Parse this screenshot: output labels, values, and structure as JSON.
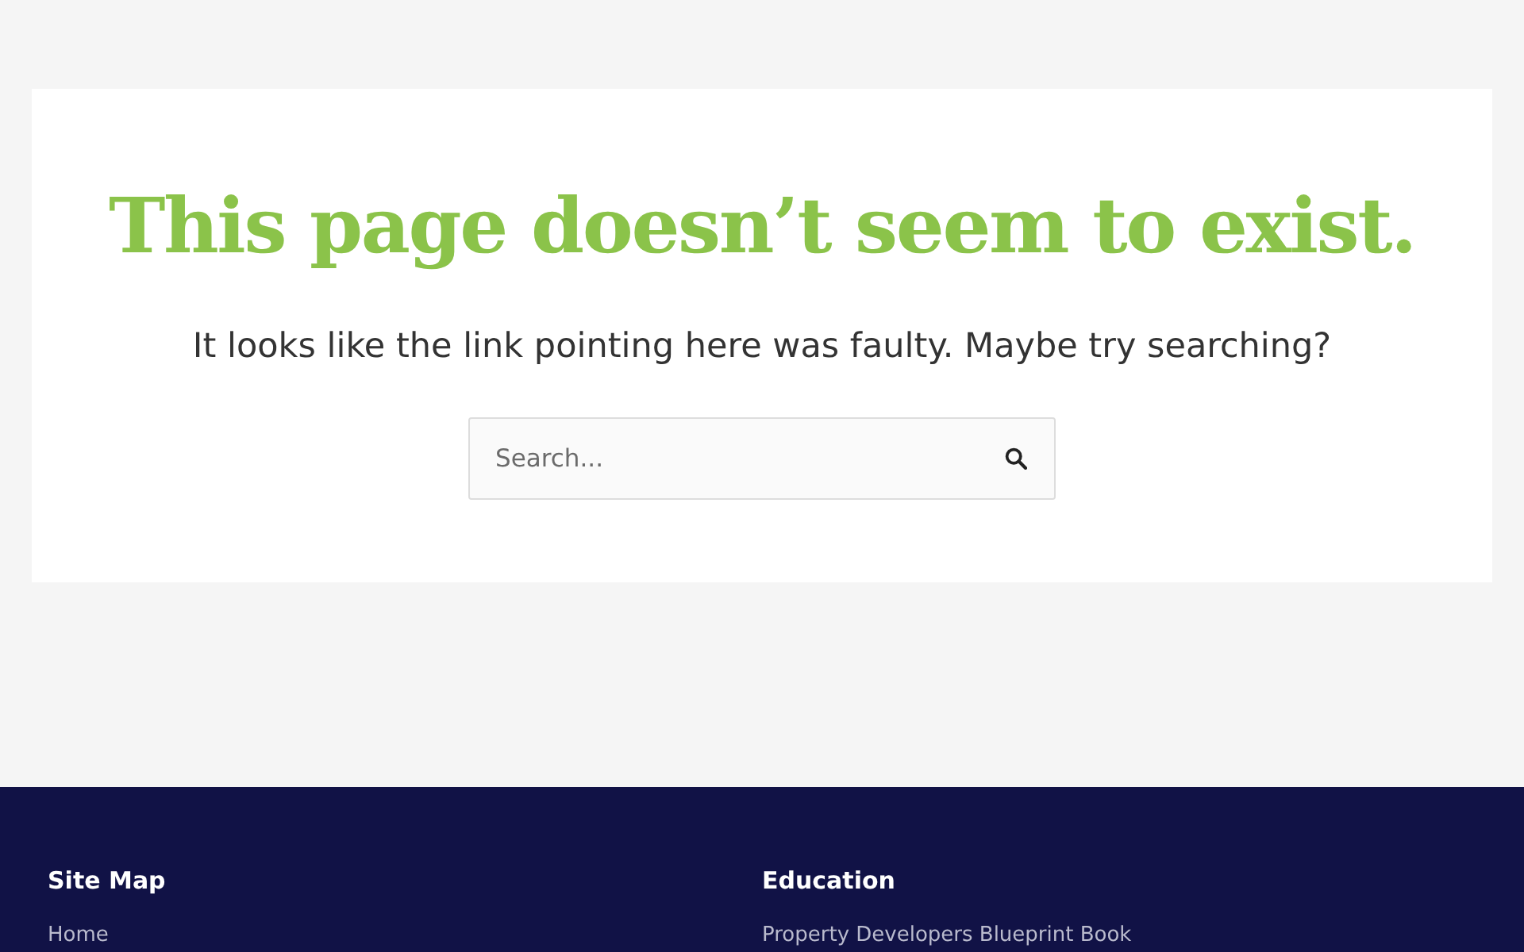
{
  "heading": "This page doesn’t seem to exist.",
  "message": "It looks like the link pointing here was faulty. Maybe try searching?",
  "search": {
    "placeholder": "Search..."
  },
  "footer": {
    "columns": [
      {
        "title": "Site Map",
        "links": [
          "Home"
        ]
      },
      {
        "title": "Education",
        "links": [
          "Property Developers Blueprint Book"
        ]
      }
    ]
  }
}
